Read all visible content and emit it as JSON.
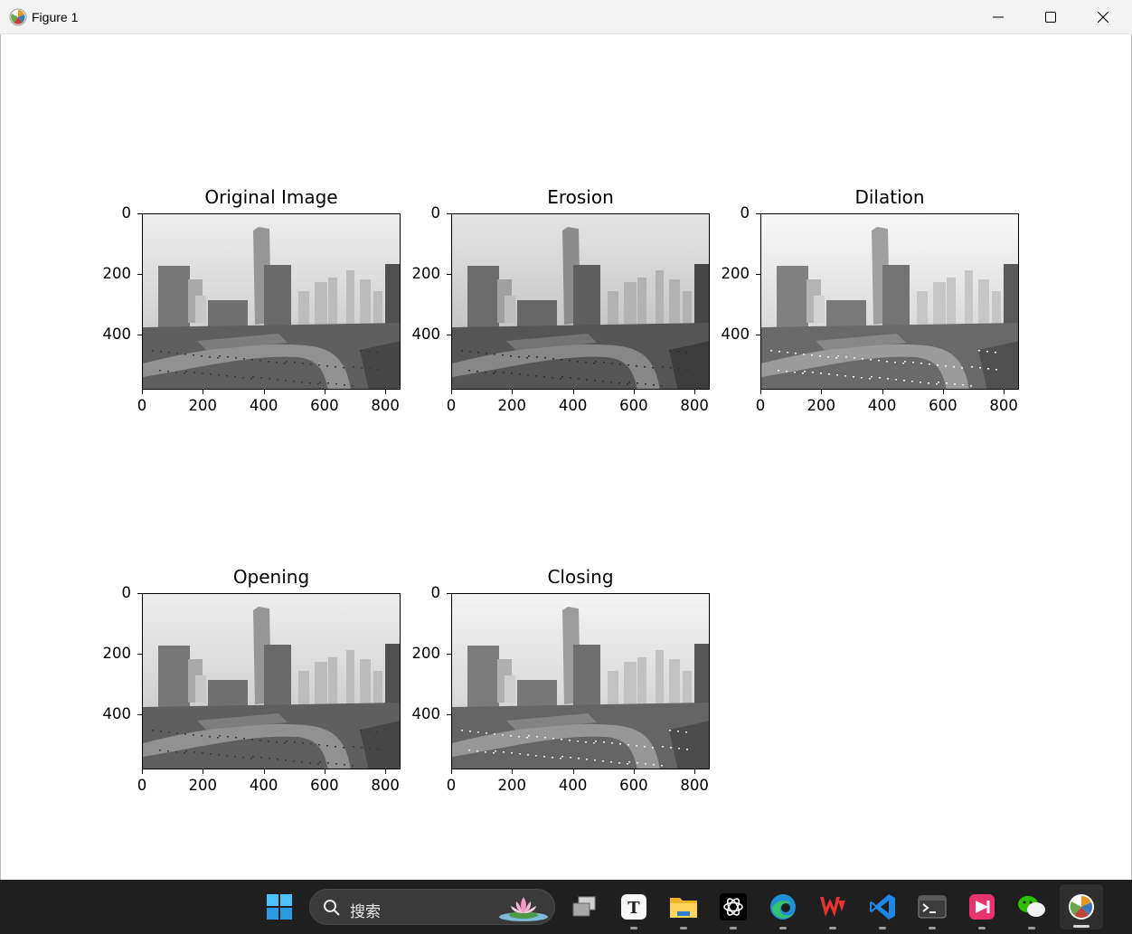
{
  "window": {
    "title": "Figure 1",
    "icon": "matplotlib-icon",
    "controls": [
      "minimize-icon",
      "maximize-icon",
      "close-icon"
    ]
  },
  "figure": {
    "subplots": [
      {
        "title": "Original Image",
        "variant": "original"
      },
      {
        "title": "Erosion",
        "variant": "erosion"
      },
      {
        "title": "Dilation",
        "variant": "dilation"
      },
      {
        "title": "Opening",
        "variant": "opening"
      },
      {
        "title": "Closing",
        "variant": "closing"
      }
    ],
    "x_ticks": [
      "0",
      "200",
      "400",
      "600",
      "800"
    ],
    "y_ticks": [
      "0",
      "200",
      "400"
    ],
    "image_content": "grayscale hazy city skyline photograph"
  },
  "taskbar": {
    "search_placeholder": "搜索",
    "items": [
      "windows-start-icon",
      "task-view-icon",
      "typora-icon",
      "file-explorer-icon",
      "chatgpt-icon",
      "edge-icon",
      "wps-icon",
      "vscode-icon",
      "terminal-icon",
      "media-app-icon",
      "wechat-icon",
      "matplotlib-icon"
    ],
    "colors": {
      "background": "#1f1f1f",
      "accent": "#3a3a3a"
    }
  }
}
